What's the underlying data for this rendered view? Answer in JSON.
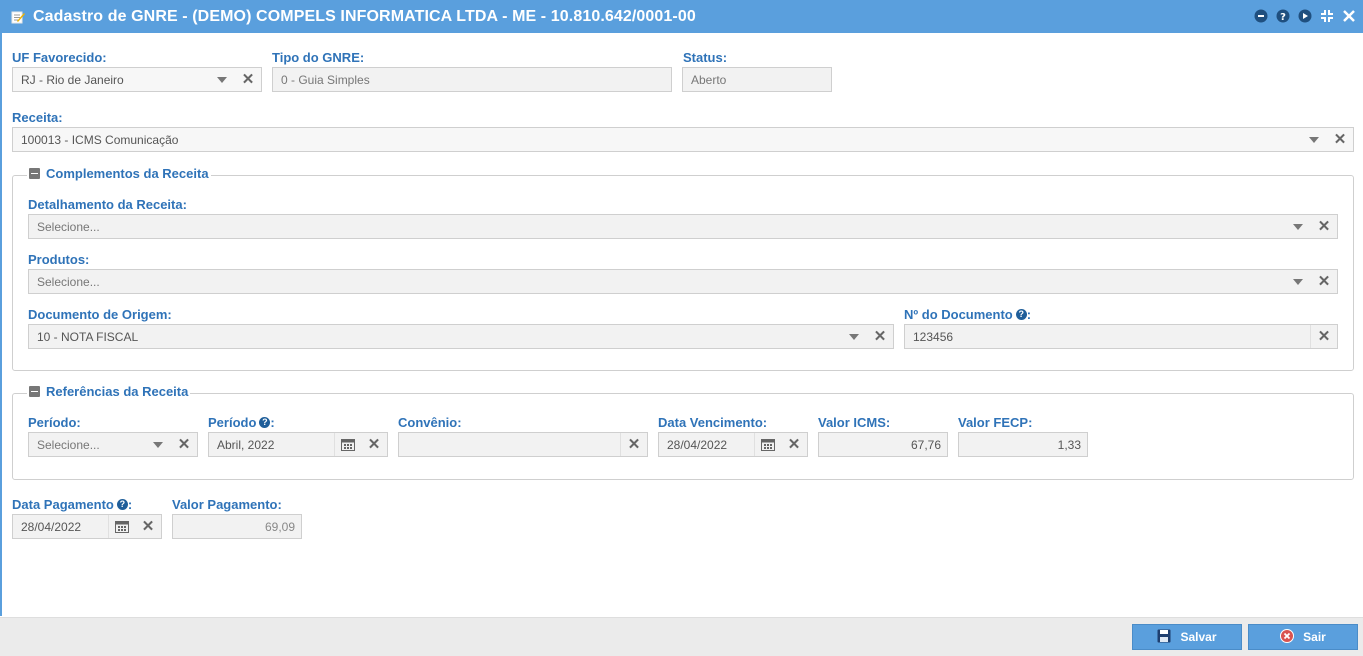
{
  "window": {
    "title": "Cadastro de GNRE - (DEMO) COMPELS INFORMATICA LTDA - ME - 10.810.642/0001-00",
    "accent_color": "#5a9fdd",
    "title_icons": [
      "minimize-icon",
      "help-icon",
      "next-icon",
      "compress-icon",
      "close-icon"
    ]
  },
  "form": {
    "uf_favorecido": {
      "label": "UF Favorecido:",
      "value": "RJ - Rio de Janeiro"
    },
    "tipo_gnre": {
      "label": "Tipo do GNRE:",
      "value": "0 - Guia Simples"
    },
    "status": {
      "label": "Status:",
      "value": "Aberto"
    },
    "receita": {
      "label": "Receita:",
      "value": "100013 - ICMS Comunicação"
    }
  },
  "complementos": {
    "legend": "Complementos da Receita",
    "detalhamento": {
      "label": "Detalhamento da Receita:",
      "placeholder": "Selecione..."
    },
    "produtos": {
      "label": "Produtos:",
      "placeholder": "Selecione..."
    },
    "documento_origem": {
      "label": "Documento de Origem:",
      "value": "10 - NOTA FISCAL"
    },
    "numero_documento": {
      "label": "Nº do Documento",
      "suffix": ":",
      "value": "123456"
    }
  },
  "referencias": {
    "legend": "Referências da Receita",
    "periodo": {
      "label": "Período:",
      "placeholder": "Selecione..."
    },
    "periodo2": {
      "label": "Período",
      "suffix": ":",
      "value": "Abril, 2022"
    },
    "convenio": {
      "label": "Convênio:",
      "value": ""
    },
    "data_vencimento": {
      "label": "Data Vencimento:",
      "value": "28/04/2022"
    },
    "valor_icms": {
      "label": "Valor ICMS:",
      "value": "67,76"
    },
    "valor_fecp": {
      "label": "Valor FECP:",
      "value": "1,33"
    }
  },
  "pagamento": {
    "data_pagamento": {
      "label": "Data Pagamento",
      "suffix": ":",
      "value": "28/04/2022"
    },
    "valor_pagamento": {
      "label": "Valor Pagamento:",
      "value": "69,09"
    }
  },
  "footer": {
    "save_label": "Salvar",
    "exit_label": "Sair"
  },
  "help_glyph": "?",
  "clear_glyph": "✕"
}
